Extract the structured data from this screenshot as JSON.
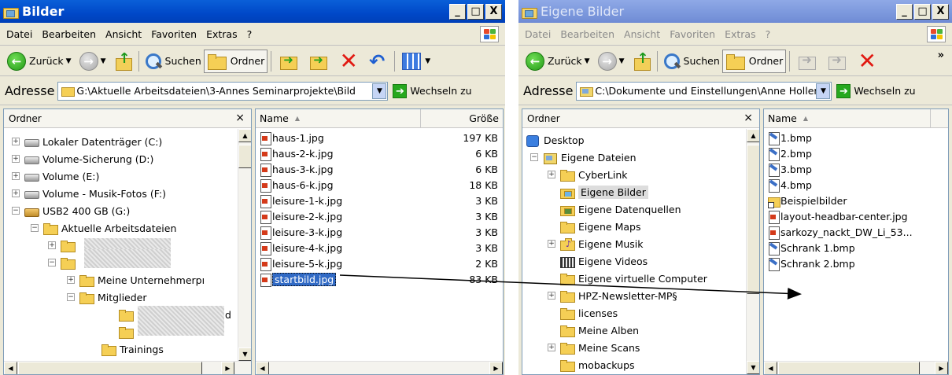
{
  "left_window": {
    "title": "Bilder",
    "title_buttons": [
      "_",
      "□",
      "X"
    ],
    "menu": [
      "Datei",
      "Bearbeiten",
      "Ansicht",
      "Favoriten",
      "Extras",
      "?"
    ],
    "toolbar": {
      "back_label": "Zurück",
      "search_label": "Suchen",
      "folders_label": "Ordner"
    },
    "address": {
      "label": "Adresse",
      "path": "G:\\Aktuelle Arbeitsdateien\\3-Annes Seminarprojekte\\Bild",
      "go_label": "Wechseln zu"
    },
    "tree": {
      "header": "Ordner",
      "close": "×",
      "items": [
        {
          "label": "Lokaler Datenträger (C:)"
        },
        {
          "label": "Volume-Sicherung (D:)"
        },
        {
          "label": "Volume (E:)"
        },
        {
          "label": "Volume - Musik-Fotos (F:)"
        },
        {
          "label": "USB2 400 GB (G:)"
        },
        {
          "label": "Aktuelle Arbeitsdateien"
        },
        {
          "label": "Meine Unternehmerpı"
        },
        {
          "label": "Mitglieder"
        },
        {
          "label": "d"
        },
        {
          "label": "Trainings"
        }
      ]
    },
    "files": {
      "col_name": "Name",
      "col_size": "Größe",
      "sort_arrow": "▲",
      "rows": [
        {
          "name": "haus-1.jpg",
          "size": "197 KB"
        },
        {
          "name": "haus-2-k.jpg",
          "size": "6 KB"
        },
        {
          "name": "haus-3-k.jpg",
          "size": "6 KB"
        },
        {
          "name": "haus-6-k.jpg",
          "size": "18 KB"
        },
        {
          "name": "leisure-1-k.jpg",
          "size": "3 KB"
        },
        {
          "name": "leisure-2-k.jpg",
          "size": "3 KB"
        },
        {
          "name": "leisure-3-k.jpg",
          "size": "3 KB"
        },
        {
          "name": "leisure-4-k.jpg",
          "size": "3 KB"
        },
        {
          "name": "leisure-5-k.jpg",
          "size": "2 KB"
        },
        {
          "name": "startbild.jpg",
          "size": "83 KB",
          "selected": true
        }
      ]
    }
  },
  "right_window": {
    "title": "Eigene Bilder",
    "title_buttons": [
      "_",
      "□",
      "X"
    ],
    "menu": [
      "Datei",
      "Bearbeiten",
      "Ansicht",
      "Favoriten",
      "Extras",
      "?"
    ],
    "toolbar": {
      "back_label": "Zurück",
      "search_label": "Suchen",
      "folders_label": "Ordner",
      "more": "»"
    },
    "address": {
      "label": "Adresse",
      "path": "C:\\Dokumente und Einstellungen\\Anne Holler",
      "go_label": "Wechseln zu"
    },
    "tree": {
      "header": "Ordner",
      "close": "×",
      "items": [
        {
          "label": "Desktop"
        },
        {
          "label": "Eigene Dateien"
        },
        {
          "label": "CyberLink"
        },
        {
          "label": "Eigene Bilder"
        },
        {
          "label": "Eigene Datenquellen"
        },
        {
          "label": "Eigene Maps"
        },
        {
          "label": "Eigene Musik"
        },
        {
          "label": "Eigene Videos"
        },
        {
          "label": "Eigene virtuelle Computer"
        },
        {
          "label": "HPZ-Newsletter-MP§"
        },
        {
          "label": "licenses"
        },
        {
          "label": "Meine Alben"
        },
        {
          "label": "Meine Scans"
        },
        {
          "label": "mobackups"
        }
      ]
    },
    "files": {
      "col_name": "Name",
      "sort_arrow": "▲",
      "rows": [
        {
          "name": "1.bmp"
        },
        {
          "name": "2.bmp"
        },
        {
          "name": "3.bmp"
        },
        {
          "name": "4.bmp"
        },
        {
          "name": "Beispielbilder"
        },
        {
          "name": "layout-headbar-center.jpg"
        },
        {
          "name": "sarkozy_nackt_DW_Li_53..."
        },
        {
          "name": "Schrank 1.bmp"
        },
        {
          "name": "Schrank 2.bmp"
        }
      ]
    }
  },
  "colors": {
    "title_active": "#0a5fd8",
    "title_inactive": "#8fa9e6",
    "selection": "#316ac5",
    "window_face": "#ece9d8"
  }
}
